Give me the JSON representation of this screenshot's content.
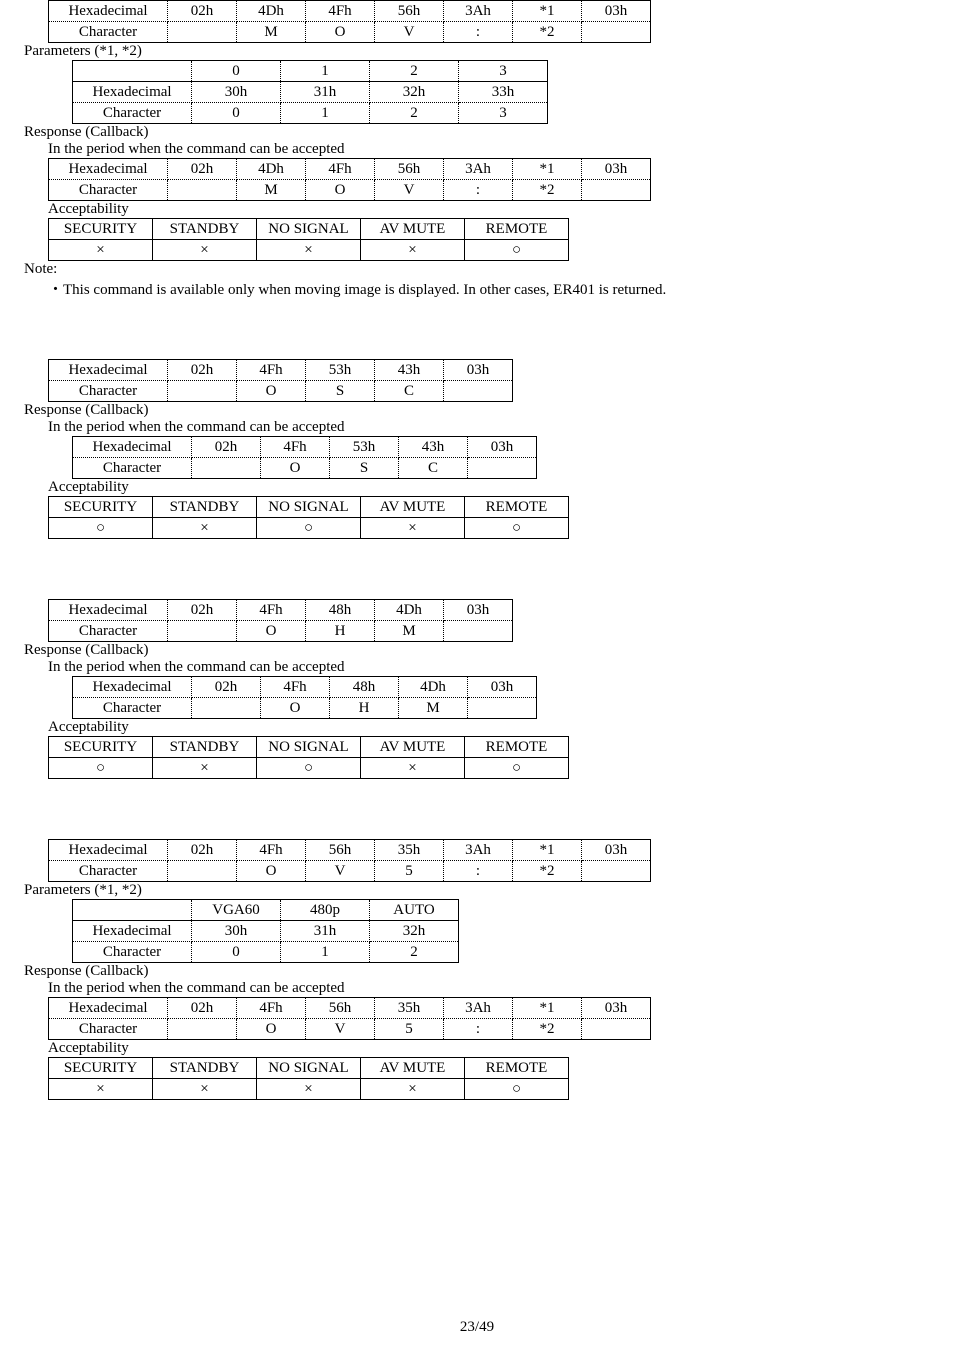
{
  "labels": {
    "hexadecimal": "Hexadecimal",
    "character": "Character",
    "parameters": "Parameters (*1, *2)",
    "response": "Response (Callback)",
    "period": "In the period when the command can be accepted",
    "acceptability": "Acceptability",
    "note": "Note:",
    "note_text": "・This command is available only when moving image is displayed. In other cases, ER401 is returned."
  },
  "block1": {
    "top": {
      "hex": [
        "02h",
        "4Dh",
        "4Fh",
        "56h",
        "3Ah",
        "*1",
        "03h"
      ],
      "chr": [
        "",
        "M",
        "O",
        "V",
        ":",
        "*2",
        ""
      ]
    },
    "params": {
      "hdr": [
        "",
        "0",
        "1",
        "2",
        "3"
      ],
      "hex": [
        "Hexadecimal",
        "30h",
        "31h",
        "32h",
        "33h"
      ],
      "chr": [
        "Character",
        "0",
        "1",
        "2",
        "3"
      ]
    },
    "resp": {
      "hex": [
        "02h",
        "4Dh",
        "4Fh",
        "56h",
        "3Ah",
        "*1",
        "03h"
      ],
      "chr": [
        "",
        "M",
        "O",
        "V",
        ":",
        "*2",
        ""
      ]
    },
    "acc": {
      "hdr": [
        "SECURITY",
        "STANDBY",
        "NO SIGNAL",
        "AV MUTE",
        "REMOTE"
      ],
      "val": [
        "×",
        "×",
        "×",
        "×",
        "○"
      ]
    }
  },
  "block2": {
    "top": {
      "hex": [
        "02h",
        "4Fh",
        "53h",
        "43h",
        "03h"
      ],
      "chr": [
        "",
        "O",
        "S",
        "C",
        ""
      ]
    },
    "resp": {
      "hex": [
        "02h",
        "4Fh",
        "53h",
        "43h",
        "03h"
      ],
      "chr": [
        "",
        "O",
        "S",
        "C",
        ""
      ]
    },
    "acc": {
      "hdr": [
        "SECURITY",
        "STANDBY",
        "NO SIGNAL",
        "AV MUTE",
        "REMOTE"
      ],
      "val": [
        "○",
        "×",
        "○",
        "×",
        "○"
      ]
    }
  },
  "block3": {
    "top": {
      "hex": [
        "02h",
        "4Fh",
        "48h",
        "4Dh",
        "03h"
      ],
      "chr": [
        "",
        "O",
        "H",
        "M",
        ""
      ]
    },
    "resp": {
      "hex": [
        "02h",
        "4Fh",
        "48h",
        "4Dh",
        "03h"
      ],
      "chr": [
        "",
        "O",
        "H",
        "M",
        ""
      ]
    },
    "acc": {
      "hdr": [
        "SECURITY",
        "STANDBY",
        "NO SIGNAL",
        "AV MUTE",
        "REMOTE"
      ],
      "val": [
        "○",
        "×",
        "○",
        "×",
        "○"
      ]
    }
  },
  "block4": {
    "top": {
      "hex": [
        "02h",
        "4Fh",
        "56h",
        "35h",
        "3Ah",
        "*1",
        "03h"
      ],
      "chr": [
        "",
        "O",
        "V",
        "5",
        ":",
        "*2",
        ""
      ]
    },
    "params": {
      "hdr": [
        "",
        "VGA60",
        "480p",
        "AUTO"
      ],
      "hex": [
        "Hexadecimal",
        "30h",
        "31h",
        "32h"
      ],
      "chr": [
        "Character",
        "0",
        "1",
        "2"
      ]
    },
    "resp": {
      "hex": [
        "02h",
        "4Fh",
        "56h",
        "35h",
        "3Ah",
        "*1",
        "03h"
      ],
      "chr": [
        "",
        "O",
        "V",
        "5",
        ":",
        "*2",
        ""
      ]
    },
    "acc": {
      "hdr": [
        "SECURITY",
        "STANDBY",
        "NO SIGNAL",
        "AV MUTE",
        "REMOTE"
      ],
      "val": [
        "×",
        "×",
        "×",
        "×",
        "○"
      ]
    }
  },
  "footer": "23/49"
}
